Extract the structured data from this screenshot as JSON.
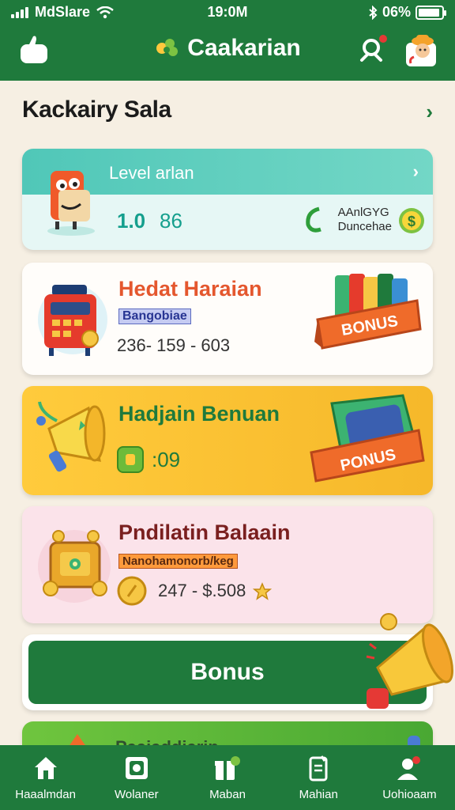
{
  "status": {
    "carrier": "MdSlare",
    "time": "19:0M",
    "battery": "06%"
  },
  "header": {
    "title": "Caakarian"
  },
  "section": {
    "title": "Kackairy Sala"
  },
  "cards": {
    "level": {
      "title": "Level arlan",
      "value1": "1.0",
      "value2": "86",
      "side_line1": "AAnlGYG",
      "side_line2": "Duncehae"
    },
    "hedat": {
      "title": "Hedat Haraian",
      "tag": "Bangobiae",
      "range": "236- 159 - 603",
      "badge": "BONUS"
    },
    "hadjain": {
      "title": "Hadjain Benuan",
      "value": ":09",
      "badge": "PONUS"
    },
    "pndilatin": {
      "title": "Pndilatin Balaain",
      "tag": "Nanohamonorb/keg",
      "range": "247 - $.508"
    },
    "cta": {
      "label": "Bonus"
    },
    "partial": {
      "title": "Paaiaddiarin"
    }
  },
  "nav": [
    {
      "label": "Haaalmdan",
      "icon": "home-icon"
    },
    {
      "label": "Wolaner",
      "icon": "wallet-icon"
    },
    {
      "label": "Maban",
      "icon": "gift-icon"
    },
    {
      "label": "Mahian",
      "icon": "clipboard-icon"
    },
    {
      "label": "Uohioaam",
      "icon": "profile-icon"
    }
  ],
  "colors": {
    "primary": "#1f7a3c",
    "teal": "#50c7b8",
    "orange": "#e4572e",
    "yellow": "#ffcb3c",
    "pink": "#fbe3ea"
  }
}
